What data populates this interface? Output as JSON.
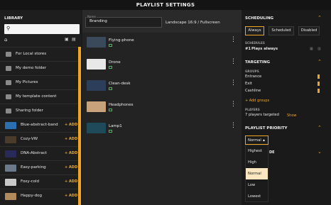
{
  "topbar": {
    "title": "PLAYLIST SETTINGS"
  },
  "library": {
    "title": "LIBRARY",
    "search_placeholder": "",
    "folders": [
      {
        "label": "For Local stores"
      },
      {
        "label": "My demo folder"
      },
      {
        "label": "My Pictures"
      },
      {
        "label": "My template content"
      },
      {
        "label": "Sharing folder"
      }
    ],
    "media": [
      {
        "label": "Blue-abstract-band",
        "add": "+ ADD",
        "color": "#2b6fb0"
      },
      {
        "label": "Cozy-VW",
        "add": "+ ADD",
        "color": "#4a3b2a"
      },
      {
        "label": "DNA-Abstract",
        "add": "+ ADD",
        "color": "#2a2a5a"
      },
      {
        "label": "Easy-parking",
        "add": "+ ADD",
        "color": "#6a7a8a"
      },
      {
        "label": "Foxy-cold",
        "add": "+ ADD",
        "color": "#c9c9c9"
      },
      {
        "label": "Happy-dog",
        "add": "+ ADD",
        "color": "#b08a5a"
      }
    ]
  },
  "center": {
    "name_label": "Name",
    "name_value": "Branding",
    "layout": "Landscape 16:9 / Fullscreen",
    "items": [
      {
        "label": "Flying-phone",
        "color": "#3a4a5a"
      },
      {
        "label": "Drone",
        "color": "#e8e8e8"
      },
      {
        "label": "Clean-desk",
        "color": "#2d3e5a"
      },
      {
        "label": "Headphones",
        "color": "#c8a27a"
      },
      {
        "label": "Lamp1",
        "color": "#1e4a5a"
      }
    ]
  },
  "right": {
    "scheduling": {
      "title": "SCHEDULING",
      "buttons": [
        "Always",
        "Scheduled",
        "Disabled"
      ],
      "active": "Always",
      "schedules_label": "SCHEDULES",
      "schedule_num": "#1",
      "schedule_text": "Plays always"
    },
    "targeting": {
      "title": "TARGETING",
      "groups_label": "GROUPS",
      "groups": [
        "Entrance",
        "Exit",
        "Cashline"
      ],
      "add_groups": "+ Add groups",
      "players_label": "PLAYERS",
      "players_text": "7 players targeted",
      "show": "Show"
    },
    "priority": {
      "title": "PLAYLIST PRIORITY",
      "selected": "Normal",
      "options": [
        "Highest",
        "High",
        "Normal",
        "Low",
        "Lowest"
      ],
      "partially_hidden_label": "DE"
    }
  }
}
